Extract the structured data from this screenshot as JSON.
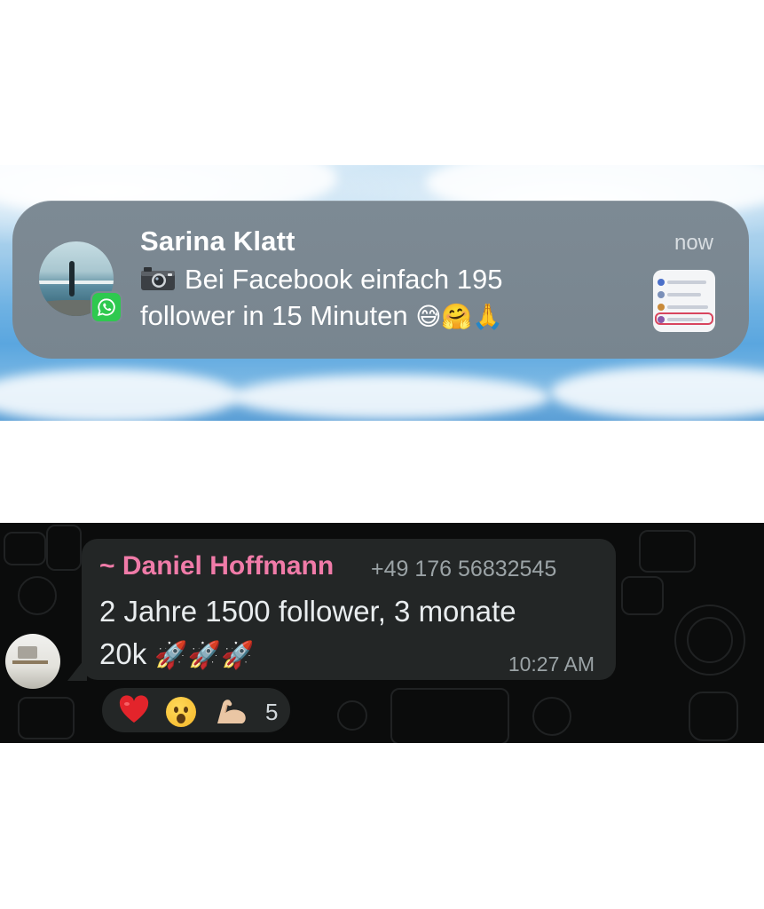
{
  "notification": {
    "sender": "Sarina Klatt",
    "time": "now",
    "body_line1": "Bei Facebook einfach 195",
    "body_line2": "follower in 15 Minuten",
    "body_emojis": "😅🤗🙏",
    "app_icon": "whatsapp-icon",
    "attachment_icon": "camera-icon"
  },
  "chat": {
    "sender_name": "~ Daniel Hoffmann",
    "sender_phone": "+49 176 56832545",
    "message_line1": "2 Jahre 1500 follower, 3 monate",
    "message_line2": "20k",
    "message_emojis": "🚀🚀🚀",
    "time": "10:27 AM",
    "reactions": {
      "emojis": [
        "heart-icon",
        "astonished-face-icon",
        "flexed-biceps-icon"
      ],
      "count": "5"
    }
  },
  "colors": {
    "sender_name": "#f07ba8",
    "whatsapp_green": "#2ec94f",
    "bubble": "#232626",
    "chat_bg": "#0b0c0c"
  }
}
